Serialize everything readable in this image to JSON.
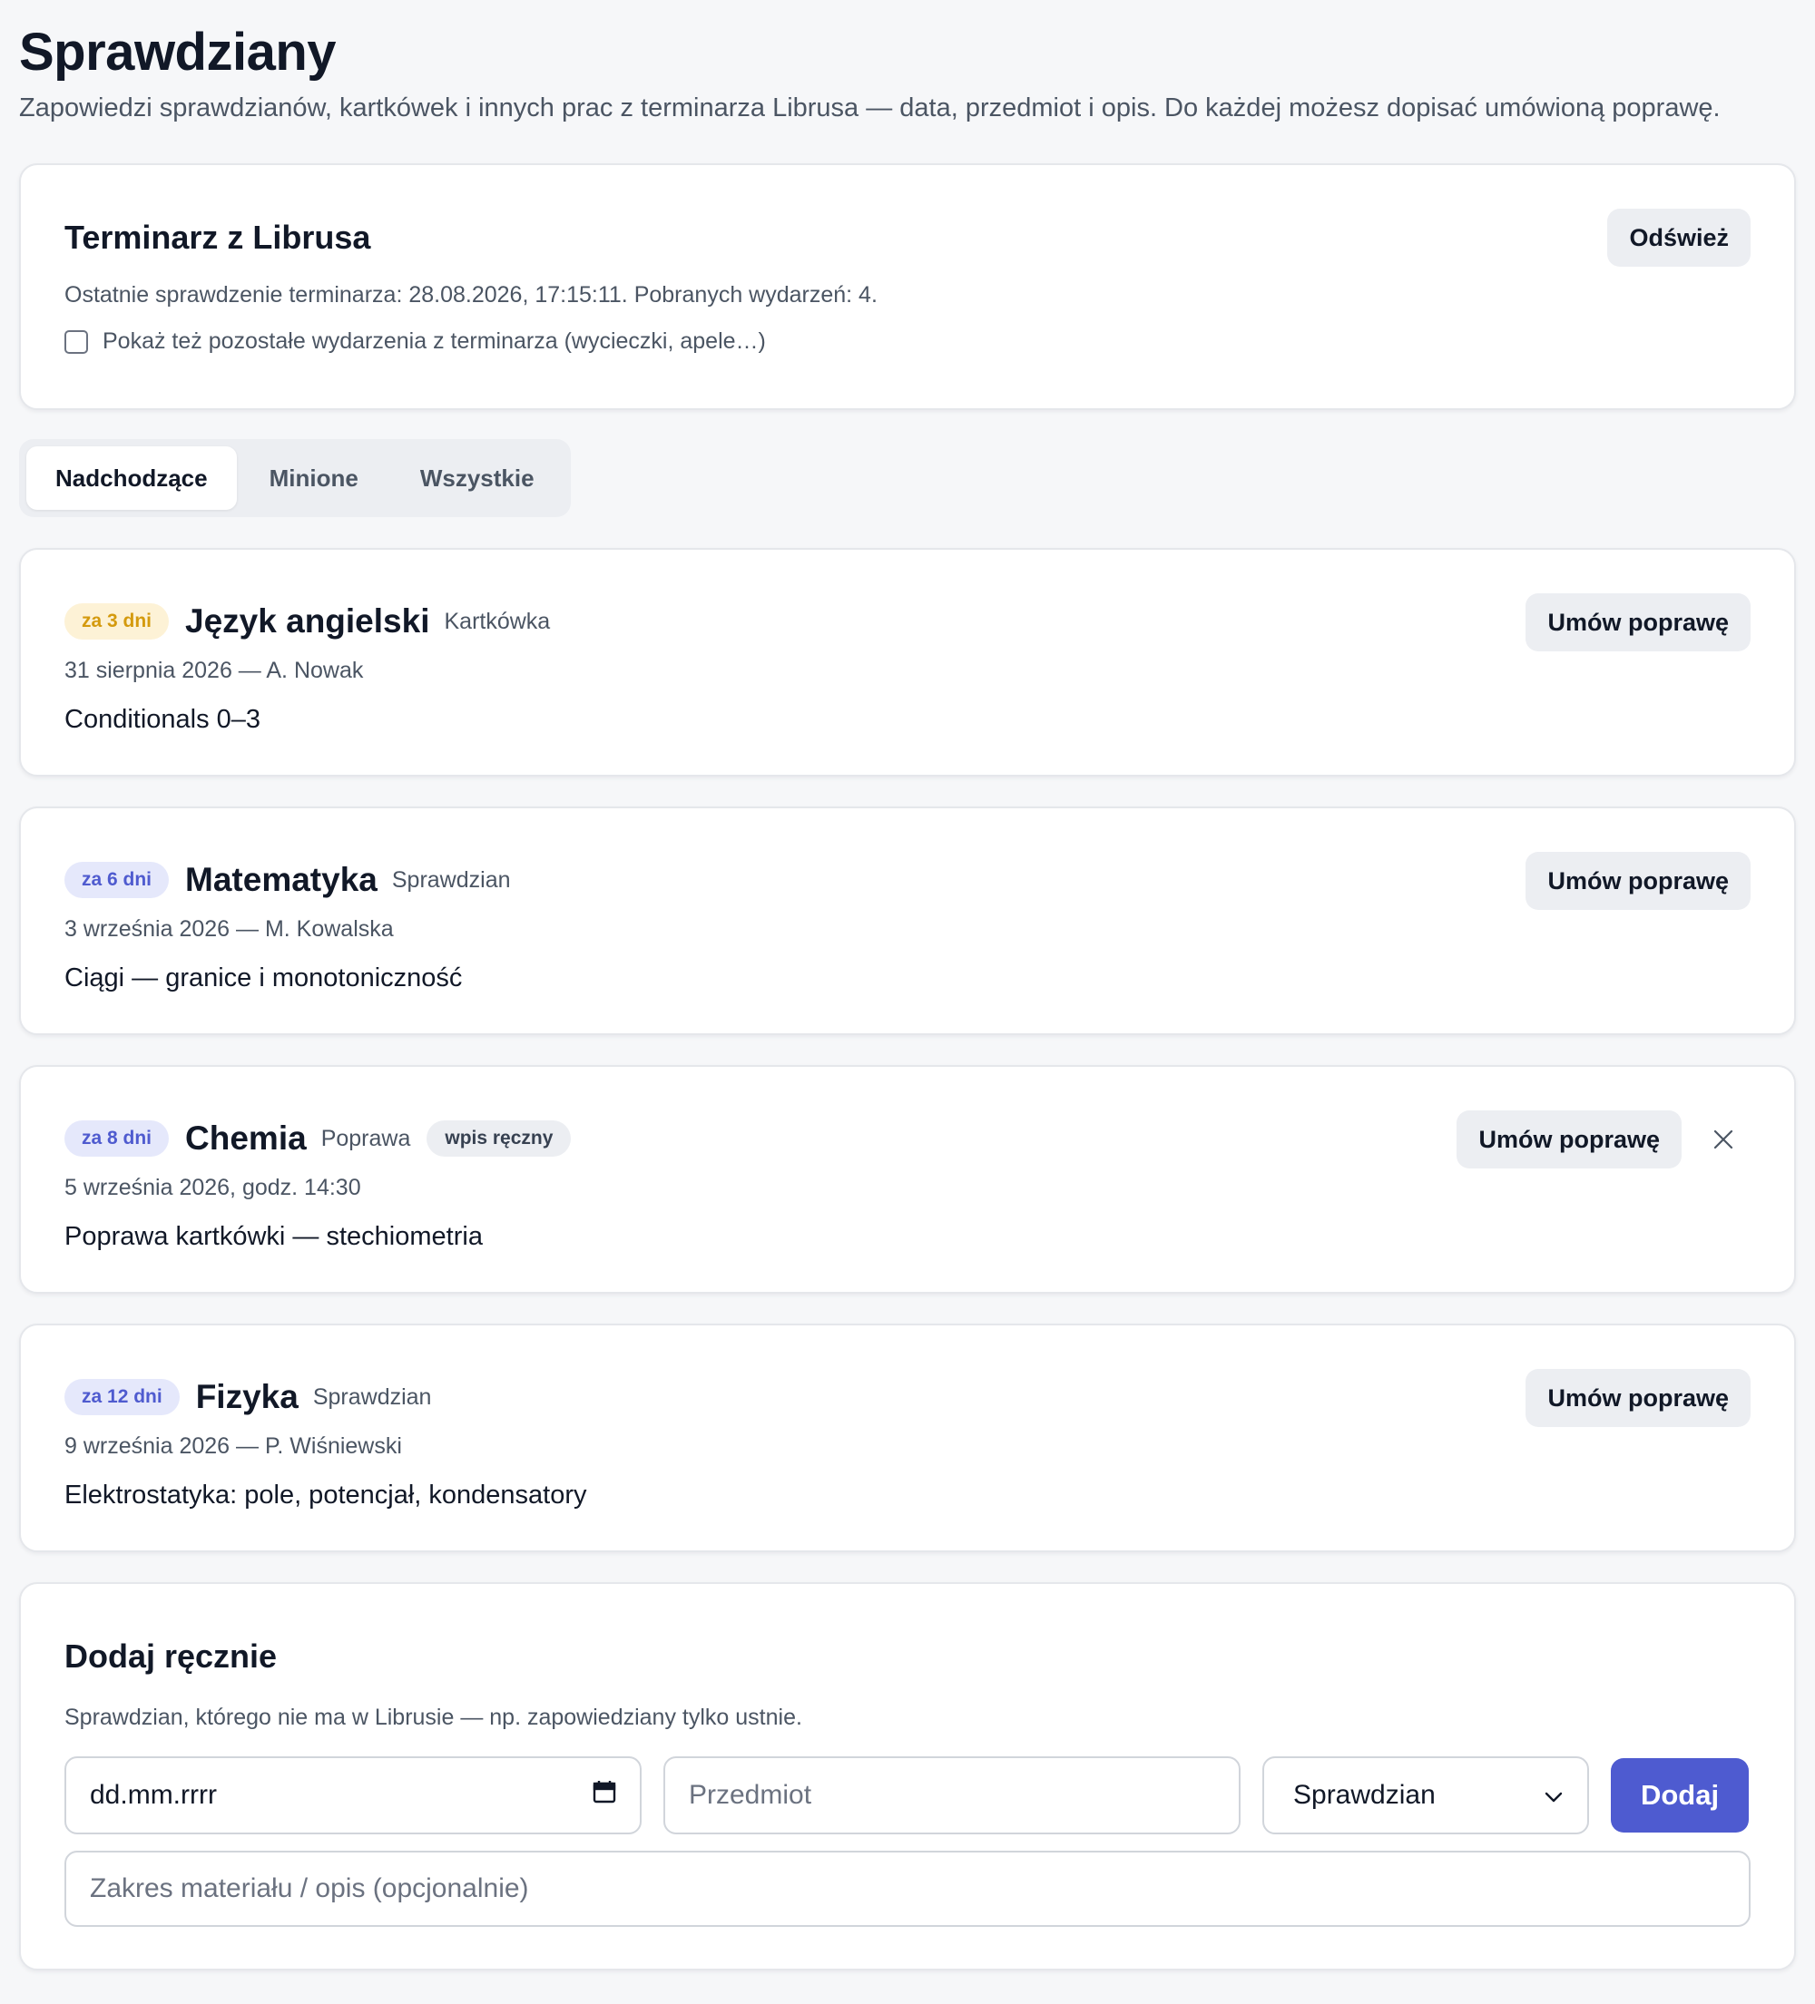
{
  "page": {
    "title": "Sprawdziany",
    "subtitle": "Zapowiedzi sprawdzianów, kartkówek i innych prac z terminarza Librusa — data, przedmiot i opis. Do każdej możesz dopisać umówioną poprawę."
  },
  "librus": {
    "heading": "Terminarz z Librusa",
    "refresh_label": "Odśwież",
    "status": "Ostatnie sprawdzenie terminarza: 28.08.2026, 17:15:11. Pobranych wydarzeń: 4.",
    "show_other_label": "Pokaż też pozostałe wydarzenia z terminarza (wycieczki, apele…)",
    "show_other_checked": false
  },
  "tabs": [
    {
      "label": "Nadchodzące",
      "active": true
    },
    {
      "label": "Minione",
      "active": false
    },
    {
      "label": "Wszystkie",
      "active": false
    }
  ],
  "exams": [
    {
      "due": "za 3 dni",
      "subject": "Język angielski",
      "type": "Kartkówka",
      "date": "31 sierpnia 2026 — A. Nowak",
      "description": "Conditionals 0–3",
      "retake_label": "Umów poprawę"
    },
    {
      "due": "za 6 dni",
      "subject": "Matematyka",
      "type": "Sprawdzian",
      "date": "3 września 2026 — M. Kowalska",
      "description": "Ciągi — granice i monotoniczność",
      "retake_label": "Umów poprawę"
    },
    {
      "due": "za 8 dni",
      "subject": "Chemia",
      "type": "Poprawa",
      "manual_badge": "wpis ręczny",
      "date": "5 września 2026, godz. 14:30",
      "description": "Poprawa kartkówki — stechiometria",
      "retake_label": "Umów poprawę"
    },
    {
      "due": "za 12 dni",
      "subject": "Fizyka",
      "type": "Sprawdzian",
      "date": "9 września 2026 — P. Wiśniewski",
      "description": "Elektrostatyka: pole, potencjał, kondensatory",
      "retake_label": "Umów poprawę"
    }
  ],
  "add_manual": {
    "heading": "Dodaj ręcznie",
    "hint": "Sprawdzian, którego nie ma w Librusie — np. zapowiedziany tylko ustnie.",
    "date_placeholder": "dd.mm.rrrr",
    "subject_placeholder": "Przedmiot",
    "type_selected": "Sprawdzian",
    "add_label": "Dodaj",
    "description_placeholder": "Zakres materiału / opis (opcjonalnie)"
  },
  "colors": {
    "accent": "#4e5bd0",
    "badge_soon_bg": "#fdf2d6",
    "badge_soon_text": "#d49a0e",
    "badge_later_bg": "#e5e8fb",
    "badge_later_text": "#4f5bcf"
  },
  "icons": {
    "calendar": "calendar-icon",
    "chevron": "chevron-down-icon",
    "remove": "close-icon"
  }
}
